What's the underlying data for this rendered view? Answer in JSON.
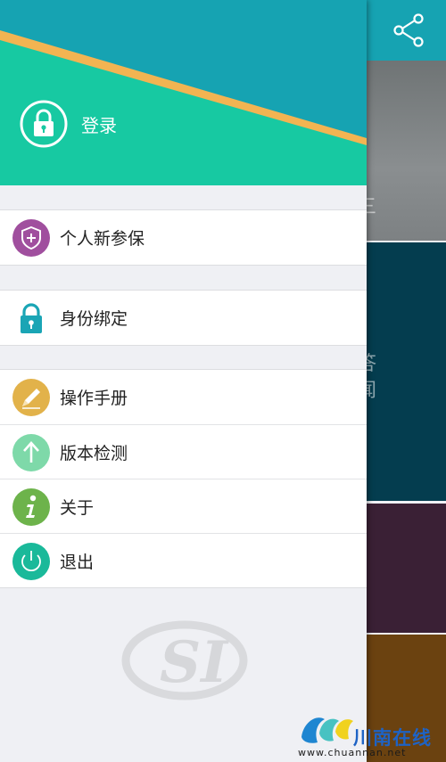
{
  "header": {
    "login_label": "登录",
    "colors": {
      "teal": "#17c9a2",
      "blue": "#16a3b2",
      "stripe": "#f2b452"
    }
  },
  "menu": {
    "groups": [
      {
        "items": [
          {
            "label": "个人新参保",
            "icon": "shield-plus-icon",
            "color": "#a04f9e"
          }
        ]
      },
      {
        "items": [
          {
            "label": "身份绑定",
            "icon": "lock-icon",
            "color": "#1aa5b5"
          }
        ]
      },
      {
        "items": [
          {
            "label": "操作手册",
            "icon": "pencil-icon",
            "color": "#e2b24a"
          },
          {
            "label": "版本检测",
            "icon": "up-arrow-icon",
            "color": "#7ed9a9"
          },
          {
            "label": "关于",
            "icon": "info-icon",
            "color": "#6db34b"
          },
          {
            "label": "退出",
            "icon": "power-icon",
            "color": "#1ab99a"
          }
        ]
      }
    ]
  },
  "watermark": {
    "text": "SI"
  },
  "background": {
    "share_icon": "share-icon",
    "glyphs": [
      "三",
      "答",
      "闻"
    ]
  },
  "brand": {
    "name": "川南在线",
    "url": "www.chuannan.net"
  }
}
